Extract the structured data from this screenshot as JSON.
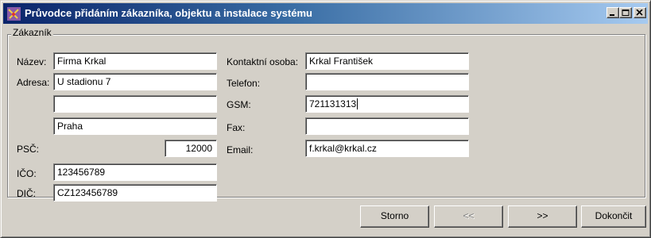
{
  "window": {
    "title": "Průvodce přidáním zákazníka, objektu a instalace systému"
  },
  "group": {
    "label": "Zákazník"
  },
  "form": {
    "nazev": {
      "label": "Název:",
      "value": "Firma Krkal"
    },
    "adresa": {
      "label": "Adresa:",
      "line1": "U stadionu 7",
      "line2": "",
      "city": "Praha"
    },
    "psc": {
      "label": "PSČ:",
      "value": "12000"
    },
    "ico": {
      "label": "IČO:",
      "value": "123456789"
    },
    "dic": {
      "label": "DIČ:",
      "value": "CZ123456789"
    },
    "kontakt": {
      "label": "Kontaktní osoba:",
      "value": "Krkal František"
    },
    "telefon": {
      "label": "Telefon:",
      "value": ""
    },
    "gsm": {
      "label": "GSM:",
      "value": "721131313"
    },
    "fax": {
      "label": "Fax:",
      "value": ""
    },
    "email": {
      "label": "Email:",
      "value": "f.krkal@krkal.cz"
    }
  },
  "buttons": {
    "storno": "Storno",
    "back": "<<",
    "next": ">>",
    "finish": "Dokončit"
  },
  "icons": {
    "app": "app-icon",
    "minimize": "minimize-icon",
    "maximize": "maximize-icon",
    "close": "close-icon"
  }
}
